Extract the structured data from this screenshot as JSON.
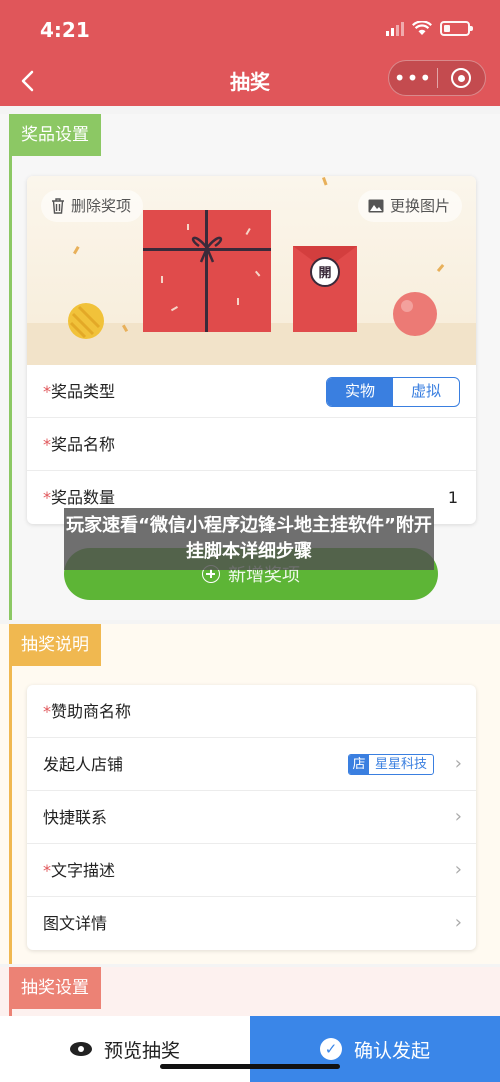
{
  "status_bar": {
    "time": "4:21"
  },
  "nav": {
    "title": "抽奖",
    "more": "•••"
  },
  "colors": {
    "header": "#e0565a",
    "prize_tag": "#8cc864",
    "desc_tag": "#f0b850",
    "settings_tag": "#ec8275",
    "accent_blue": "#3a7fe0",
    "add_green": "#5db536"
  },
  "prize_section": {
    "tag": "奖品设置",
    "delete_label": "删除奖项",
    "change_image_label": "更换图片",
    "gift_icon_text": "開",
    "rows": {
      "type_label": "奖品类型",
      "type_options": [
        "实物",
        "虚拟"
      ],
      "type_selected": "实物",
      "name_label": "奖品名称",
      "quantity_label": "奖品数量",
      "quantity_value": "1"
    },
    "add_button": "新增奖项"
  },
  "overlay_text": "玩家速看“微信小程序边锋斗地主挂软件”附开挂脚本详细步骤",
  "desc_section": {
    "tag": "抽奖说明",
    "rows": [
      {
        "label": "赞助商名称",
        "required": true
      },
      {
        "label": "发起人店铺",
        "required": false,
        "shop_badge": "店",
        "shop_name": "星星科技"
      },
      {
        "label": "快捷联系",
        "required": false
      },
      {
        "label": "文字描述",
        "required": true
      },
      {
        "label": "图文详情",
        "required": false
      }
    ]
  },
  "settings_section": {
    "tag": "抽奖设置"
  },
  "bottom_bar": {
    "preview": "预览抽奖",
    "confirm": "确认发起"
  }
}
